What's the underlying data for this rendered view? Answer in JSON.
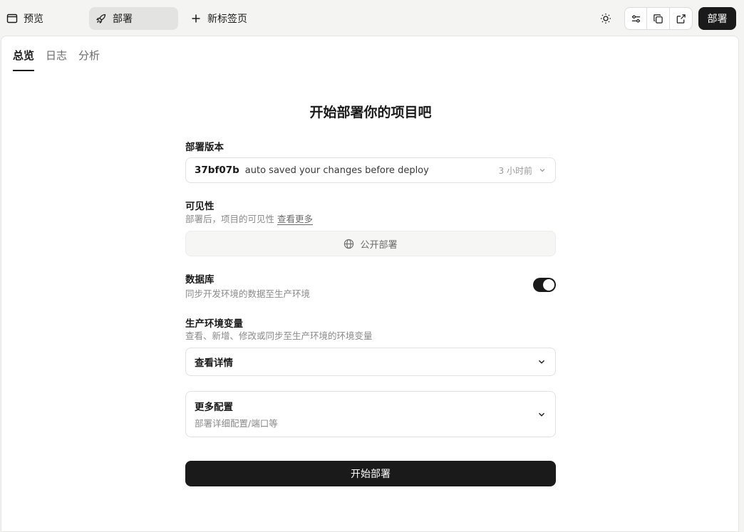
{
  "topbar": {
    "tabs": [
      {
        "label": "预览",
        "icon": "window-icon"
      },
      {
        "label": "部署",
        "icon": "rocket-icon"
      },
      {
        "label": "新标签页",
        "icon": "plus-icon"
      }
    ],
    "deploy_label": "部署"
  },
  "subtabs": [
    "总览",
    "日志",
    "分析"
  ],
  "form": {
    "title": "开始部署你的项目吧",
    "version": {
      "label": "部署版本",
      "hash": "37bf07b",
      "message": "auto saved your changes before deploy",
      "time": "3 小时前"
    },
    "visibility": {
      "label": "可见性",
      "desc": "部署后，项目的可见性",
      "more": "查看更多",
      "value": "公开部署"
    },
    "database": {
      "label": "数据库",
      "desc": "同步开发环境的数据至生产环境",
      "enabled": true
    },
    "env": {
      "label": "生产环境变量",
      "desc": "查看、新增、修改或同步至生产环境的环境变量",
      "details": "查看详情"
    },
    "more_config": {
      "title": "更多配置",
      "desc": "部署详细配置/端口等"
    },
    "submit": "开始部署"
  },
  "colors": {
    "primary": "#1a1a1a",
    "active_tab_bg": "#e3e3e1"
  }
}
